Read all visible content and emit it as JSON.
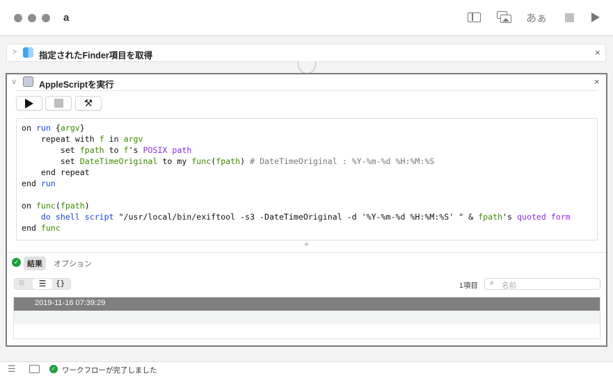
{
  "window": {
    "title": "a",
    "toolbar": {
      "library_icon": "sidebar-icon",
      "media_icon": "media-browser-icon",
      "font_label": "あぁ",
      "stop_icon": "stop-icon",
      "run_icon": "play-icon"
    }
  },
  "actions": [
    {
      "title": "指定されたFinder項目を取得",
      "icon": "finder-icon",
      "expanded": false
    },
    {
      "title": "AppleScriptを実行",
      "icon": "applescript-icon",
      "expanded": true,
      "buttons": {
        "run": "play-icon",
        "stop": "stop-icon",
        "compile": "hammer-icon"
      },
      "code_lines": [
        [
          [
            "on ",
            ""
          ],
          [
            "run ",
            "kw-blue"
          ],
          [
            "{",
            ""
          ],
          [
            "argv",
            "kw-green"
          ],
          [
            "}",
            ""
          ]
        ],
        [
          [
            "    repeat with ",
            ""
          ],
          [
            "f",
            "kw-green"
          ],
          [
            " in ",
            ""
          ],
          [
            "argv",
            "kw-green"
          ]
        ],
        [
          [
            "        set ",
            ""
          ],
          [
            "fpath",
            "kw-green"
          ],
          [
            " to ",
            ""
          ],
          [
            "f",
            "kw-green"
          ],
          [
            "'s ",
            ""
          ],
          [
            "POSIX path",
            "kw-purple"
          ]
        ],
        [
          [
            "        set ",
            ""
          ],
          [
            "DateTimeOriginal",
            "kw-green"
          ],
          [
            " to my ",
            ""
          ],
          [
            "func",
            "kw-green"
          ],
          [
            "(",
            ""
          ],
          [
            "fpath",
            "kw-green"
          ],
          [
            ") ",
            ""
          ],
          [
            "# DateTimeOriginal : %Y-%m-%d %H:%M:%S",
            "kw-gray"
          ]
        ],
        [
          [
            "    end repeat",
            ""
          ]
        ],
        [
          [
            "end ",
            ""
          ],
          [
            "run",
            "kw-blue"
          ]
        ],
        [
          [
            "",
            ""
          ]
        ],
        [
          [
            "on ",
            ""
          ],
          [
            "func",
            "kw-green"
          ],
          [
            "(",
            ""
          ],
          [
            "fpath",
            "kw-green"
          ],
          [
            ")",
            ""
          ]
        ],
        [
          [
            "    ",
            ""
          ],
          [
            "do shell script",
            "kw-blue"
          ],
          [
            " \"/usr/local/bin/exiftool -s3 -DateTimeOriginal -d '%Y-%m-%d %H:%M:%S' \" & ",
            ""
          ],
          [
            "fpath",
            "kw-green"
          ],
          [
            "'s ",
            ""
          ],
          [
            "quoted form",
            "kw-purple"
          ]
        ],
        [
          [
            "end ",
            ""
          ],
          [
            "func",
            "kw-green"
          ]
        ]
      ],
      "result_tabs": {
        "results": "結果",
        "options": "オプション"
      },
      "view_modes": [
        "grid",
        "list",
        "{}"
      ],
      "item_count": "1項目",
      "search_placeholder": "名前",
      "results": [
        "2019-11-16 07:39:29"
      ]
    }
  ],
  "statusbar": {
    "message": "ワークフローが完了しました"
  },
  "colors": {
    "keyword": "#1a43d6",
    "variable": "#3e8a00",
    "property": "#8a2be2",
    "selected_row": "#7f7f7f",
    "success": "#1e9e3a"
  }
}
